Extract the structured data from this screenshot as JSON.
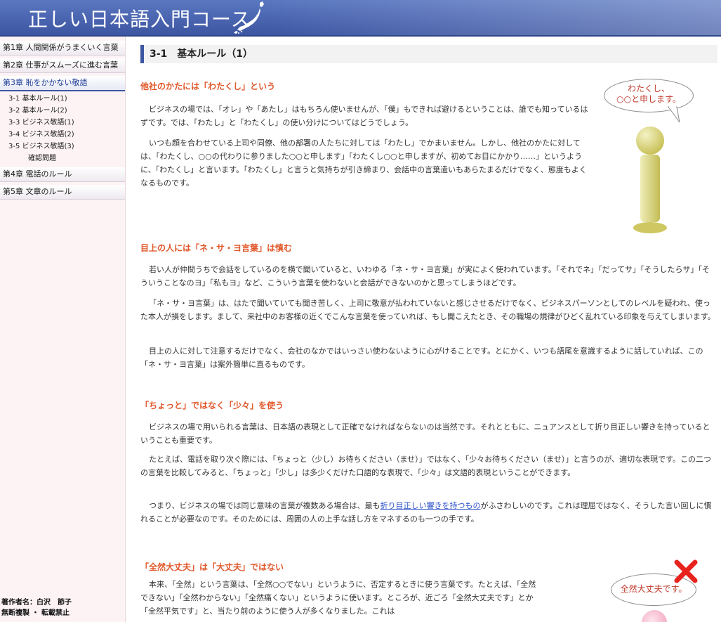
{
  "header": {
    "title": "正しい日本語入門コース"
  },
  "sidebar": {
    "chapters_before": [
      {
        "label": "第1章 人間関係がうまくいく言葉"
      },
      {
        "label": "第2章 仕事がスムーズに進む言葉"
      },
      {
        "label": "第3章 恥をかかない敬語"
      }
    ],
    "subitems": [
      {
        "label": "3-1 基本ルール(1)"
      },
      {
        "label": "3-2 基本ルール(2)"
      },
      {
        "label": "3-3 ビジネス敬語(1)"
      },
      {
        "label": "3-4 ビジネス敬語(2)"
      },
      {
        "label": "3-5 ビジネス敬語(3)"
      },
      {
        "label": "確認問題"
      }
    ],
    "chapters_after": [
      {
        "label": "第4章 電話のルール"
      },
      {
        "label": "第5章 文章のルール"
      }
    ],
    "author_line1": "著作者名：白沢　節子",
    "author_line2": "無断複製 ・ 転載禁止"
  },
  "main": {
    "section_title": "3-1　基本ルール（1）",
    "sections": [
      {
        "heading": "他社のかたには「わたくし」という",
        "paragraphs": [
          "ビジネスの場では、「オレ」や「あたし」はもちろん使いませんが、「僕」もできれば避けるということは、誰でも知っているはずです。では、「わたし」と「わたくし」の使い分けについてはどうでしょう。",
          "いつも顔を合わせている上司や同僚、他の部署の人たちに対しては「わたし」でかまいません。しかし、他社のかたに対しては、「わたくし、○○の代わりに参りました○○と申します」「わたくし○○と申しますが、初めてお目にかかり……」というように、「わたくし」と言います。「わたくし」と言うと気持ちが引き締まり、会話中の言葉遣いもあらたまるだけでなく、態度もよくなるものです。"
        ]
      },
      {
        "heading": "目上の人には「ネ・サ・ヨ言葉」は慎む",
        "paragraphs": [
          "若い人が仲間うちで会話をしているのを横で聞いていると、いわゆる「ネ・サ・ヨ言葉」が実によく使われています。「それでネ」「だってサ」「そうしたらサ」「そういうことなのヨ」「私もヨ」など、こういう言葉を使わないと会話ができないのかと思ってしまうほどです。",
          "「ネ・サ・ヨ言葉」は、はたで聞いていても聞き苦しく、上司に敬意が払われていないと感じさせるだけでなく、ビジネスパーソンとしてのレベルを疑われ、使った本人が損をします。まして、来社中のお客様の近くでこんな言葉を使っていれば、もし聞こえたとき、その職場の規律がひどく乱れている印象を与えてしまいます。",
          "目上の人に対して注意するだけでなく、会社のなかではいっさい使わないように心がけることです。とにかく、いつも語尾を意識するように話していれば、この「ネ・サ・ヨ言葉」は案外簡単に直るものです。"
        ]
      },
      {
        "heading": "「ちょっと」ではなく「少々」を使う",
        "paragraphs": [
          "ビジネスの場で用いられる言葉は、日本語の表現として正確でなければならないのは当然です。それとともに、ニュアンスとして折り目正しい響きを持っているということも重要です。",
          "たとえば、電話を取り次ぐ際には、「ちょっと（少し）お待ちください（ませ）」ではなく、「少々お待ちください（ませ）」と言うのが、適切な表現です。この二つの言葉を比較してみると、「ちょっと」「少し」は多少くだけた口語的な表現で、「少々」は文語的表現ということができます。"
        ],
        "p3_before": "つまり、ビジネスの場では同じ意味の言葉が複数ある場合は、最も",
        "p3_link": "折り目正しい響きを持つもの",
        "p3_after": "がふさわしいのです。これは理屈ではなく、そうした言い回しに慣れることが必要なのです。そのためには、周囲の人の上手な話し方をマネするのも一つの手です。"
      },
      {
        "heading": "「全然大丈夫」は「大丈夫」ではない",
        "paragraphs": [
          "本来、「全然」という言葉は、「全然○○でない」というように、否定するときに使う言葉です。たとえば、「全然できない」「全然わからない」「全然痛くない」というように使います。ところが、近ごろ「全然大丈夫です」とか「全然平気です」と、当たり前のように使う人が多くなりました。これは"
        ]
      }
    ],
    "bubble1_line1": "わたくし、",
    "bubble1_line2": "○○と申します。",
    "bubble2": "全然大丈夫です。"
  },
  "colors": {
    "header_blue": "#4a64b0",
    "heading_orange": "#e0572a",
    "sidebar_bg": "#fdf3f5",
    "link_blue": "#2a4fc8",
    "figure_yellow": "#d8d47a",
    "cross_red": "#e8231e"
  }
}
